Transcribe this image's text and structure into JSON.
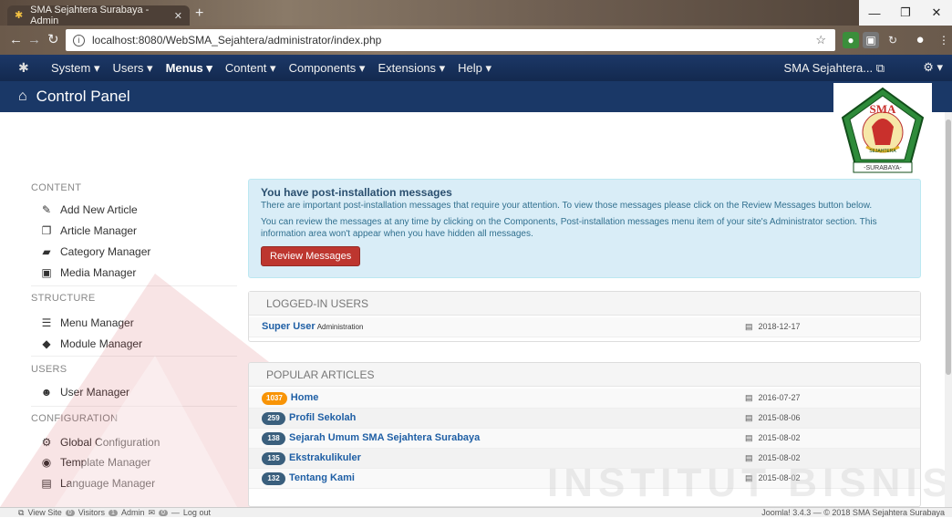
{
  "browser": {
    "tab_title": "SMA Sejahtera Surabaya - Admin",
    "url": "localhost:8080/WebSMA_Sejahtera/administrator/index.php"
  },
  "topnav": {
    "items": [
      "System",
      "Users",
      "Menus",
      "Content",
      "Components",
      "Extensions",
      "Help"
    ],
    "site_name": "SMA Sejahtera..."
  },
  "header": {
    "title": "Control Panel"
  },
  "logo": {
    "top_text": "SMA",
    "mid_text": "SEJAHTERA",
    "bottom_text": "-SURABAYA-"
  },
  "sidebar": {
    "content_heading": "CONTENT",
    "content_items": [
      "Add New Article",
      "Article Manager",
      "Category Manager",
      "Media Manager"
    ],
    "structure_heading": "STRUCTURE",
    "structure_items": [
      "Menu Manager",
      "Module Manager"
    ],
    "users_heading": "USERS",
    "users_items": [
      "User Manager"
    ],
    "config_heading": "CONFIGURATION",
    "config_items": [
      "Global Configuration",
      "Template Manager",
      "Language Manager"
    ]
  },
  "alert": {
    "heading": "You have post-installation messages",
    "line1": "There are important post-installation messages that require your attention. To view those messages please click on the Review Messages button below.",
    "line2": "You can review the messages at any time by clicking on the Components, Post-installation messages menu item of your site's Administrator section. This information area won't appear when you have hidden all messages.",
    "button": "Review Messages"
  },
  "logged_in": {
    "heading": "LOGGED-IN USERS",
    "rows": [
      {
        "name": "Super User",
        "sub": "Administration",
        "date": "2018-12-17"
      }
    ]
  },
  "popular": {
    "heading": "POPULAR ARTICLES",
    "rows": [
      {
        "hits": "1037",
        "title": "Home",
        "date": "2016-07-27"
      },
      {
        "hits": "259",
        "title": "Profil Sekolah",
        "date": "2015-08-06"
      },
      {
        "hits": "138",
        "title": "Sejarah Umum SMA Sejahtera Surabaya",
        "date": "2015-08-02"
      },
      {
        "hits": "135",
        "title": "Ekstrakulikuler",
        "date": "2015-08-02"
      },
      {
        "hits": "132",
        "title": "Tentang Kami",
        "date": "2015-08-02"
      }
    ]
  },
  "statusbar": {
    "view_site": "View Site",
    "visitors_count": "0",
    "visitors": "Visitors",
    "admin_count": "1",
    "admin": "Admin",
    "msg_count": "0",
    "logout": "Log out",
    "version": "Joomla! 3.4.3 — © 2018 SMA Sejahtera Surabaya"
  },
  "watermark": "INSTITUT BISNIS",
  "colors": {
    "nav": "#1a3867",
    "alert_bg": "#d9edf7",
    "button": "#bd362f",
    "link": "#1f5fa5",
    "badge_orange": "#f89406"
  }
}
